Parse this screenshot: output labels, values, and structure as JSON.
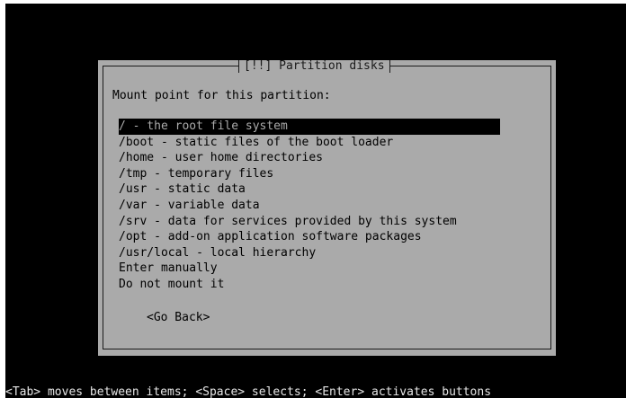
{
  "dialog": {
    "title": "[!!] Partition disks",
    "prompt": "Mount point for this partition:",
    "options": [
      "/ - the root file system",
      "/boot - static files of the boot loader",
      "/home - user home directories",
      "/tmp - temporary files",
      "/usr - static data",
      "/var - variable data",
      "/srv - data for services provided by this system",
      "/opt - add-on application software packages",
      "/usr/local - local hierarchy",
      "Enter manually",
      "Do not mount it"
    ],
    "selected_index": 0,
    "go_back_label": "<Go Back>"
  },
  "status_line": "<Tab> moves between items; <Space> selects; <Enter> activates buttons",
  "colors": {
    "screen_bg": "#000000",
    "dialog_bg": "#aaaaaa",
    "selected_bg": "#000000",
    "text": "#000000",
    "status_text": "#e6e6e6"
  }
}
